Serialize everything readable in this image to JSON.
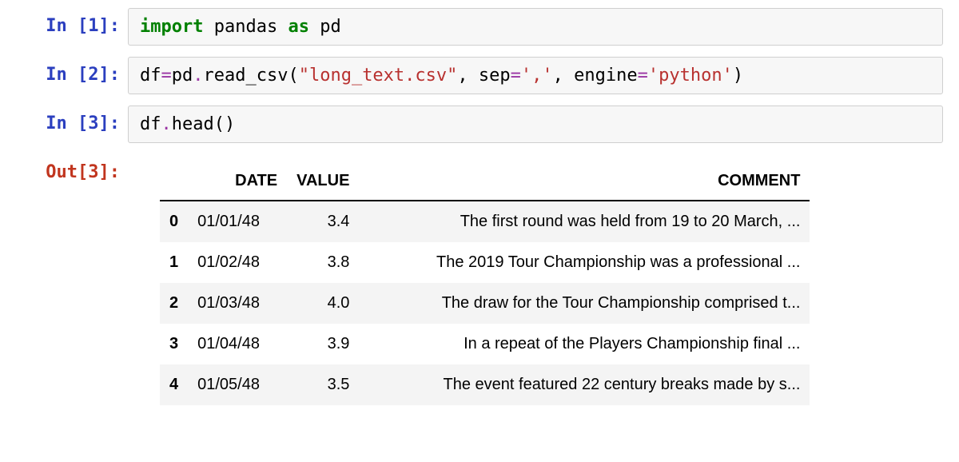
{
  "cells": {
    "cell1": {
      "prompt": "In [1]:",
      "code": {
        "kw_import": "import",
        "name_pandas": "pandas",
        "kw_as": "as",
        "name_pd": "pd"
      }
    },
    "cell2": {
      "prompt": "In [2]:",
      "code": {
        "lhs": "df",
        "eq": "=",
        "rhs_obj": "pd",
        "dot1": ".",
        "rhs_fn": "read_csv",
        "lp": "(",
        "arg1": "\"long_text.csv\"",
        "comma1": ",",
        "kw_sep": " sep",
        "eq2": "=",
        "arg2": "','",
        "comma2": ",",
        "kw_engine": " engine",
        "eq3": "=",
        "arg3": "'python'",
        "rp": ")"
      }
    },
    "cell3": {
      "prompt": "In [3]:",
      "code": {
        "obj": "df",
        "dot": ".",
        "fn": "head",
        "lp": "(",
        "rp": ")"
      },
      "out_prompt": "Out[3]:"
    }
  },
  "table": {
    "columns": [
      "DATE",
      "VALUE",
      "COMMENT"
    ],
    "rows": [
      {
        "idx": "0",
        "date": "01/01/48",
        "value": "3.4",
        "comment": "The first round was held from 19 to 20 March, ..."
      },
      {
        "idx": "1",
        "date": "01/02/48",
        "value": "3.8",
        "comment": "The 2019 Tour Championship was a professional ..."
      },
      {
        "idx": "2",
        "date": "01/03/48",
        "value": "4.0",
        "comment": "The draw for the Tour Championship comprised t..."
      },
      {
        "idx": "3",
        "date": "01/04/48",
        "value": "3.9",
        "comment": "In a repeat of the Players Championship final ..."
      },
      {
        "idx": "4",
        "date": "01/05/48",
        "value": "3.5",
        "comment": "The event featured 22 century breaks made by s..."
      }
    ]
  }
}
